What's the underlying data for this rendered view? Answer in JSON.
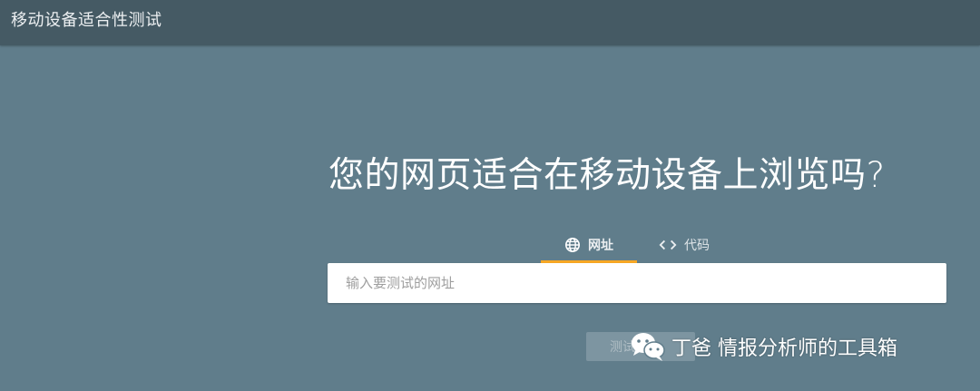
{
  "app": {
    "title": "移动设备适合性测试"
  },
  "main": {
    "headline": "您的网页适合在移动设备上浏览吗?",
    "tabs": [
      {
        "label": "网址",
        "icon": "globe-icon",
        "active": true
      },
      {
        "label": "代码",
        "icon": "code-brackets-icon",
        "active": false
      }
    ],
    "url_input": {
      "value": "",
      "placeholder": "输入要测试的网址"
    },
    "test_button": {
      "label": "测试"
    }
  },
  "watermark": {
    "text": "丁爸 情报分析师的工具箱",
    "icon": "wechat-icon"
  },
  "colors": {
    "background": "#607d8b",
    "topbar": "#455a64",
    "tab_indicator": "#f9a825",
    "input_bg": "#ffffff",
    "button_disabled": "#7d95a1"
  }
}
